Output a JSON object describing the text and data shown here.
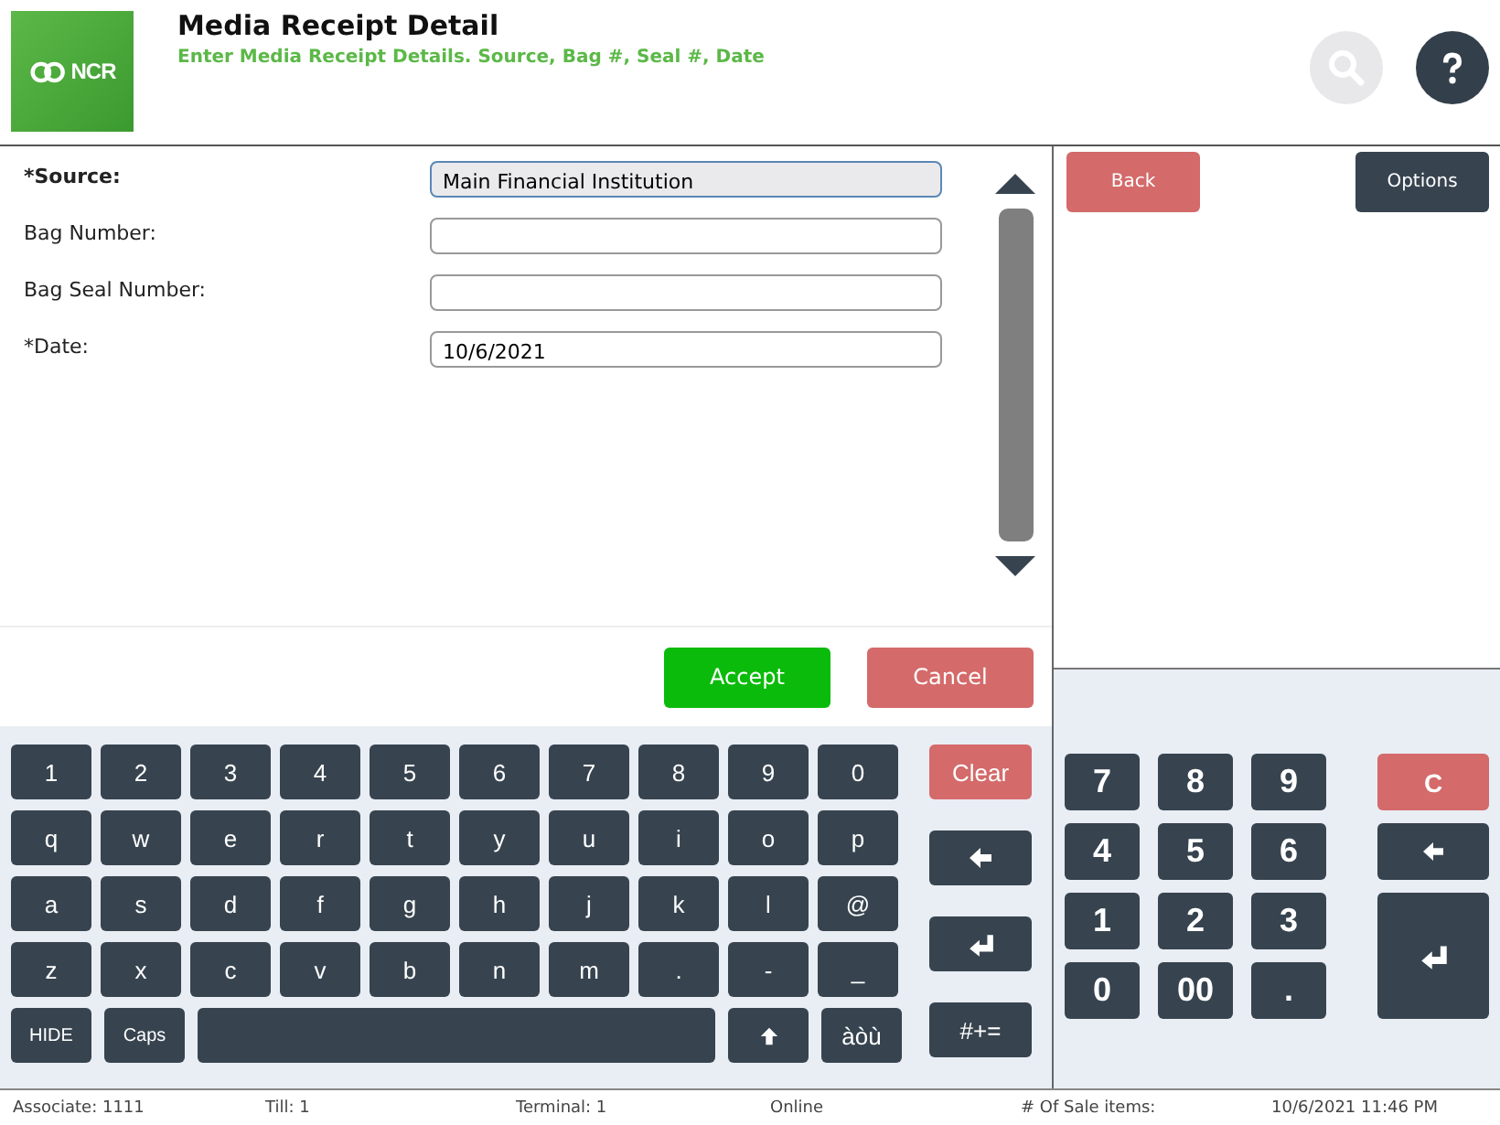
{
  "header": {
    "title": "Media Receipt Detail",
    "subtitle": "Enter Media Receipt Details. Source, Bag #, Seal #, Date",
    "logo": "NCR",
    "search_disabled": true
  },
  "form": {
    "fields": [
      {
        "label": "*Source:",
        "value": "Main Financial Institution",
        "focused": true
      },
      {
        "label": "Bag Number:",
        "focused": false
      },
      {
        "label": "Bag Seal Number:",
        "focused": false
      },
      {
        "label": "*Date:",
        "value": "10/6/2021",
        "focused": false
      }
    ]
  },
  "actions": [
    {
      "label": "Accept",
      "kind": "confirm"
    },
    {
      "label": "Cancel",
      "kind": "cancel"
    }
  ],
  "side_buttons": [
    {
      "label": "Back",
      "kind": "cancel"
    },
    {
      "label": "Options",
      "kind": "neutral"
    }
  ],
  "keyboard": {
    "rows": [
      [
        {
          "label": "1"
        },
        {
          "label": "2"
        },
        {
          "label": "3"
        },
        {
          "label": "4"
        },
        {
          "label": "5"
        },
        {
          "label": "6"
        },
        {
          "label": "7"
        },
        {
          "label": "8"
        },
        {
          "label": "9"
        },
        {
          "label": "0"
        }
      ],
      [
        {
          "label": "q"
        },
        {
          "label": "w"
        },
        {
          "label": "e"
        },
        {
          "label": "r"
        },
        {
          "label": "t"
        },
        {
          "label": "y"
        },
        {
          "label": "u"
        },
        {
          "label": "i"
        },
        {
          "label": "o"
        },
        {
          "label": "p"
        }
      ],
      [
        {
          "label": "a"
        },
        {
          "label": "s"
        },
        {
          "label": "d"
        },
        {
          "label": "f"
        },
        {
          "label": "g"
        },
        {
          "label": "h"
        },
        {
          "label": "j"
        },
        {
          "label": "k"
        },
        {
          "label": "l"
        },
        {
          "label": "@"
        }
      ],
      [
        {
          "label": "z"
        },
        {
          "label": "x"
        },
        {
          "label": "c"
        },
        {
          "label": "v"
        },
        {
          "label": "b"
        },
        {
          "label": "n"
        },
        {
          "label": "m"
        },
        {
          "label": "."
        },
        {
          "label": "-"
        },
        {
          "label": "_"
        }
      ]
    ],
    "bottom_row": [
      {
        "label": "HIDE",
        "kind": "small"
      },
      {
        "label": "Caps",
        "kind": "small"
      },
      {
        "kind": "space"
      },
      {
        "kind": "shift"
      },
      {
        "label": "àòù"
      }
    ],
    "side": [
      {
        "label": "Clear",
        "kind": "clear"
      },
      {
        "kind": "backspace"
      },
      {
        "kind": "enter"
      },
      {
        "label": "#+="
      }
    ]
  },
  "numpad": {
    "keys": [
      {
        "label": "7"
      },
      {
        "label": "8"
      },
      {
        "label": "9"
      },
      {
        "label": "4"
      },
      {
        "label": "5"
      },
      {
        "label": "6"
      },
      {
        "label": "1"
      },
      {
        "label": "2"
      },
      {
        "label": "3"
      },
      {
        "label": "0"
      },
      {
        "label": "00"
      },
      {
        "label": "."
      }
    ],
    "side": [
      {
        "label": "C",
        "kind": "clear"
      },
      {
        "kind": "backspace"
      },
      {
        "kind": "enter"
      }
    ]
  },
  "status_bar": [
    "Associate: 1111",
    "Till: 1",
    "Terminal: 1",
    "Online",
    "# Of Sale items:",
    "10/6/2021 11:46 PM"
  ]
}
